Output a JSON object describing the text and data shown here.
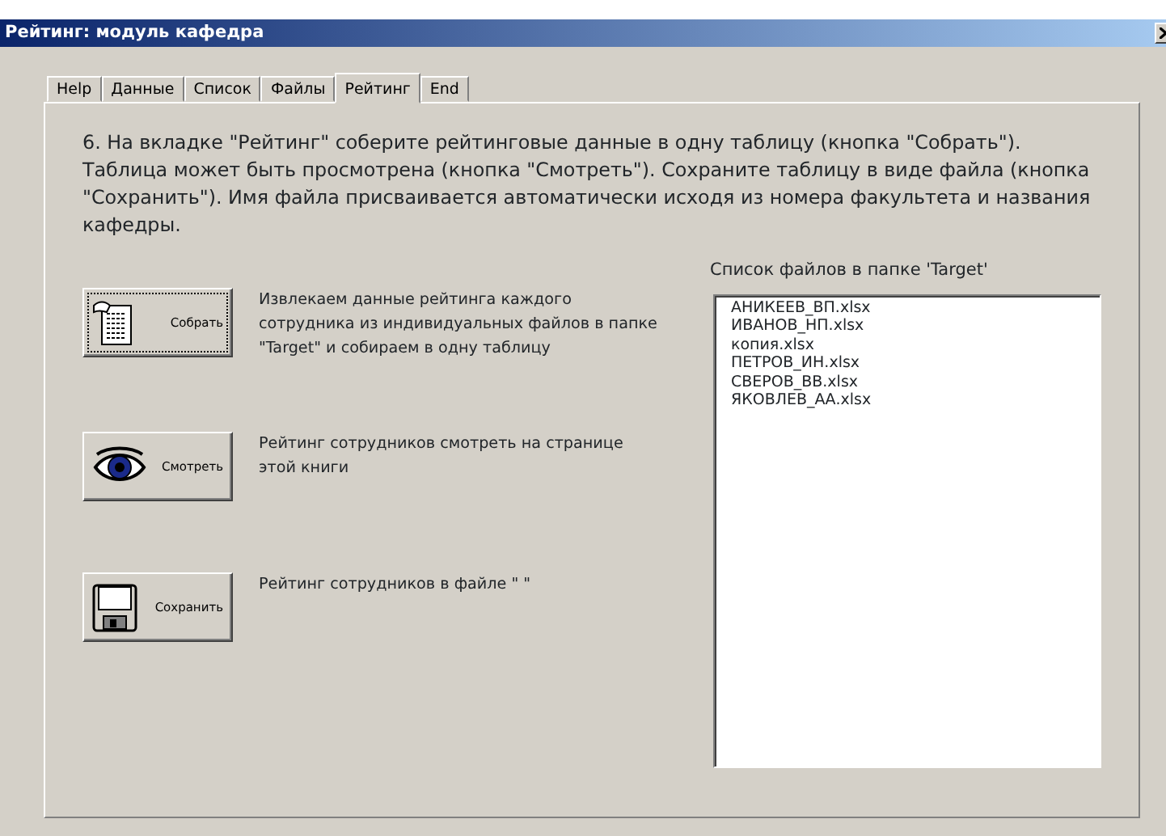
{
  "window": {
    "title": "Рейтинг: модуль кафедра"
  },
  "tabs": [
    {
      "label": "Help",
      "selected": false
    },
    {
      "label": "Данные",
      "selected": false
    },
    {
      "label": "Список",
      "selected": false
    },
    {
      "label": "Файлы",
      "selected": false
    },
    {
      "label": "Рейтинг",
      "selected": true
    },
    {
      "label": "End",
      "selected": false
    }
  ],
  "instructions": "6. На вкладке \"Рейтинг\" соберите рейтинговые данные в одну таблицу (кнопка \"Собрать\"). Таблица может быть просмотрена (кнопка \"Смотреть\"). Сохраните таблицу в виде файла (кнопка \"Сохранить\"). Имя файла присваивается автоматически исходя из номера факультета и названия кафедры.",
  "actions": [
    {
      "kind": "collect",
      "label": "Собрать",
      "focused": true,
      "description": "Извлекаем данные рейтинга каждого сотрудника из индивидуальных файлов в папке \"Target\" и собираем в одну таблицу"
    },
    {
      "kind": "view",
      "label": "Смотреть",
      "focused": false,
      "description": "Рейтинг сотрудников смотреть на странице этой книги"
    },
    {
      "kind": "save",
      "label": "Сохранить",
      "focused": false,
      "description": "Рейтинг сотрудников в файле \"    \""
    }
  ],
  "file_list": {
    "label": "Список файлов в папке 'Target'",
    "items": [
      "АНИКЕЕВ_ВП.xlsx",
      "ИВАНОВ_НП.xlsx",
      "копия.xlsx",
      "ПЕТРОВ_ИН.xlsx",
      "СВЕРОВ_ВВ.xlsx",
      "ЯКОВЛЕВ_АА.xlsx"
    ]
  }
}
